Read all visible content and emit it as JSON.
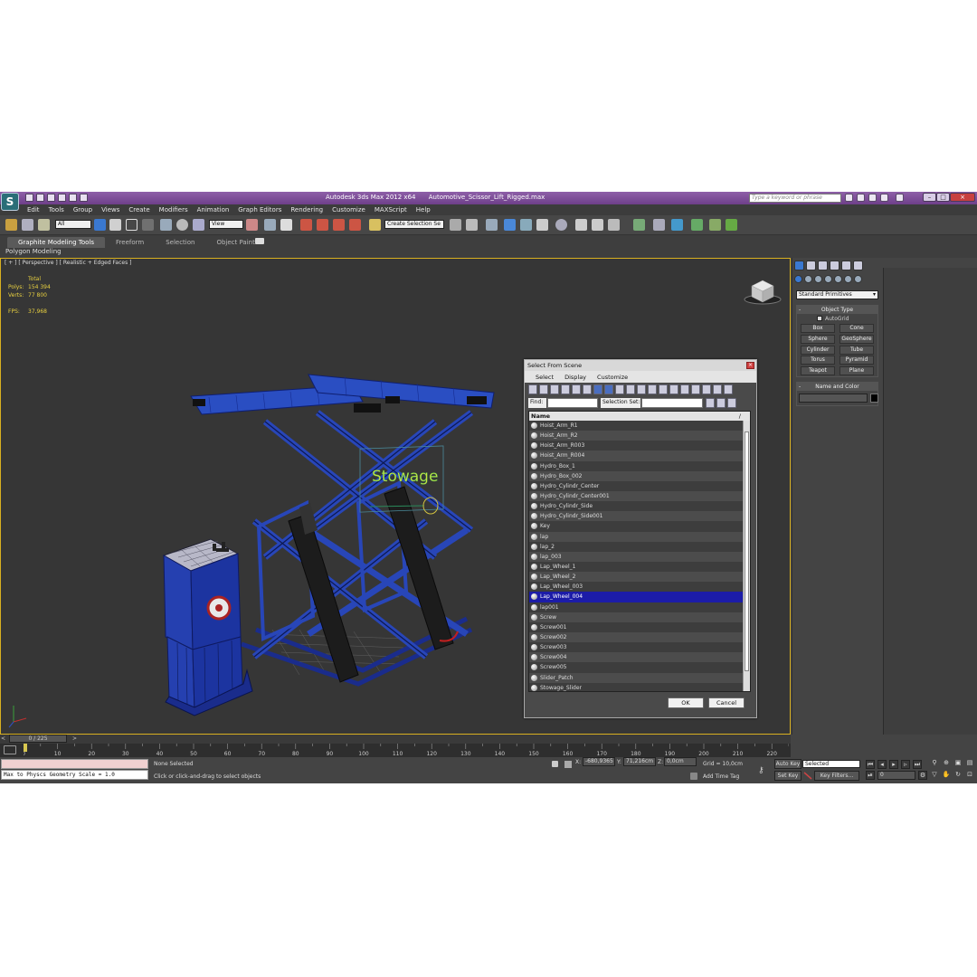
{
  "titlebar": {
    "app_title": "Autodesk 3ds Max  2012 x64",
    "file_name": "Automotive_Scissor_Lift_Rigged.max",
    "search_placeholder": "Type a keyword or phrase",
    "window_min": "–",
    "window_max": "□",
    "window_close": "×",
    "app_logo": "S"
  },
  "menu": [
    "Edit",
    "Tools",
    "Group",
    "Views",
    "Create",
    "Modifiers",
    "Animation",
    "Graph Editors",
    "Rendering",
    "Customize",
    "MAXScript",
    "Help"
  ],
  "toolbar": {
    "selection_filter": "All",
    "ref_coord": "View",
    "named_selection": "Create Selection Se"
  },
  "ribbon": {
    "tabs": [
      "Graphite Modeling Tools",
      "Freeform",
      "Selection",
      "Object Paint"
    ],
    "active_tab": 0,
    "panel_label": "Polygon Modeling"
  },
  "viewport": {
    "label": "[ + ] [ Perspective ] [ Realistic + Edged Faces ]",
    "stats": {
      "header": "Total",
      "polys_label": "Polys:",
      "polys": "154 394",
      "verts_label": "Verts:",
      "verts": "77 800",
      "fps_label": "FPS:",
      "fps": "37,968"
    },
    "scene_text": "Stowage"
  },
  "dialog": {
    "title": "Select From Scene",
    "close": "×",
    "menu": [
      "Select",
      "Display",
      "Customize"
    ],
    "find_label": "Find:",
    "selection_set_label": "Selection Set:",
    "column_header": "Name",
    "sort_glyph": "/",
    "items": [
      "Hoist_Arm_R1",
      "Hoist_Arm_R2",
      "Hoist_Arm_R003",
      "Hoist_Arm_R004",
      "Hydro_Box_1",
      "Hydro_Box_002",
      "Hydro_Cylindr_Center",
      "Hydro_Cylindr_Center001",
      "Hydro_Cylindr_Side",
      "Hydro_Cylindr_Side001",
      "Key",
      "lap",
      "lap_2",
      "lap_003",
      "Lap_Wheel_1",
      "Lap_Wheel_2",
      "Lap_Wheel_003",
      "Lap_Wheel_004",
      "lap001",
      "Screw",
      "Screw001",
      "Screw002",
      "Screw003",
      "Screw004",
      "Screw005",
      "Slider_Patch",
      "Stowage_Slider"
    ],
    "selected_index": 17,
    "ok_label": "OK",
    "cancel_label": "Cancel"
  },
  "command_panel": {
    "category": "Standard Primitives",
    "object_type_header": "Object Type",
    "autogrid_label": "AutoGrid",
    "primitives": [
      "Box",
      "Cone",
      "Sphere",
      "GeoSphere",
      "Cylinder",
      "Tube",
      "Torus",
      "Pyramid",
      "Teapot",
      "Plane"
    ],
    "name_color_header": "Name and Color",
    "rollout_toggle": "-"
  },
  "timeline": {
    "position": "0 / 225",
    "left_arrow": "<",
    "right_arrow": ">",
    "ticks": [
      "0",
      "10",
      "20",
      "30",
      "40",
      "50",
      "60",
      "70",
      "80",
      "90",
      "100",
      "110",
      "120",
      "130",
      "140",
      "150",
      "160",
      "170",
      "180",
      "190",
      "200",
      "210",
      "220"
    ]
  },
  "status": {
    "maxscript_line": "Max to Physcs Geometry Scale = 1.0",
    "selection": "None Selected",
    "prompt": "Click or click-and-drag to select objects",
    "x_label": "X:",
    "x_value": "-680,9365",
    "y_label": "Y:",
    "y_value": "71,216cm",
    "z_label": "Z:",
    "z_value": "0,0cm",
    "grid": "Grid = 10,0cm",
    "add_time_tag": "Add Time Tag",
    "auto_key": "Auto Key",
    "set_key": "Set Key",
    "key_mode": "Selected",
    "key_filters": "Key Filters...",
    "current_frame": "0"
  }
}
